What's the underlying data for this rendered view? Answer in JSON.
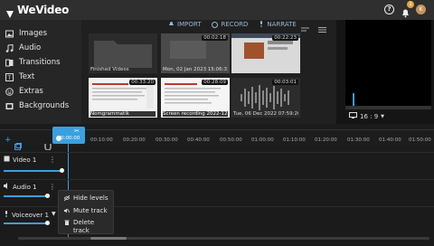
{
  "app": {
    "logo_text": "WeVideo"
  },
  "topbar": {
    "notifications_count": "1",
    "avatar_initial": "K"
  },
  "sidebar": {
    "items": [
      {
        "label": "Images",
        "icon": "image-icon"
      },
      {
        "label": "Audio",
        "icon": "music-note-icon"
      },
      {
        "label": "Transitions",
        "icon": "transitions-icon"
      },
      {
        "label": "Text",
        "icon": "text-icon"
      },
      {
        "label": "Extras",
        "icon": "extras-icon"
      },
      {
        "label": "Backgrounds",
        "icon": "backgrounds-icon"
      }
    ]
  },
  "media": {
    "toolbar": {
      "import": "IMPORT",
      "record": "RECORD",
      "narrate": "NARRATE"
    },
    "thumbs": [
      {
        "label": "Finished Videos",
        "duration": ""
      },
      {
        "label": "Mon, 02 Jan 2023 15:06:31 GMT",
        "duration": "00:02:18"
      },
      {
        "label": "2022-12-14 at 13:58:30 Screen",
        "duration": "00:22:23"
      },
      {
        "label": "Nomgrammatik",
        "duration": "00:33:20"
      },
      {
        "label": "Screen recording 2022-12-07 1",
        "duration": "00:28:09"
      },
      {
        "label": "Tue, 06 Dec 2022 07:59:20 GMT",
        "duration": "00:03:01"
      }
    ]
  },
  "preview": {
    "aspect_ratio": "16 : 9"
  },
  "timeline": {
    "playhead_time": "00:00:00",
    "ticks": [
      "00:10:00",
      "00:20:00",
      "00:30:00",
      "00:40:00",
      "00:50:00",
      "01:00:00",
      "01:10:00",
      "01:20:00",
      "01:30:00",
      "01:40:00",
      "01:50:00"
    ],
    "tracks": [
      {
        "label": "Video 1"
      },
      {
        "label": "Audio 1"
      },
      {
        "label": "Voiceover 1"
      }
    ]
  },
  "context_menu": {
    "items": [
      {
        "label": "Hide levels",
        "icon": "eye-off-icon"
      },
      {
        "label": "Mute track",
        "icon": "mute-icon"
      },
      {
        "label": "Delete track",
        "icon": "trash-icon"
      }
    ]
  },
  "colors": {
    "accent": "#3aa0e0",
    "badge": "#e8a33d"
  }
}
